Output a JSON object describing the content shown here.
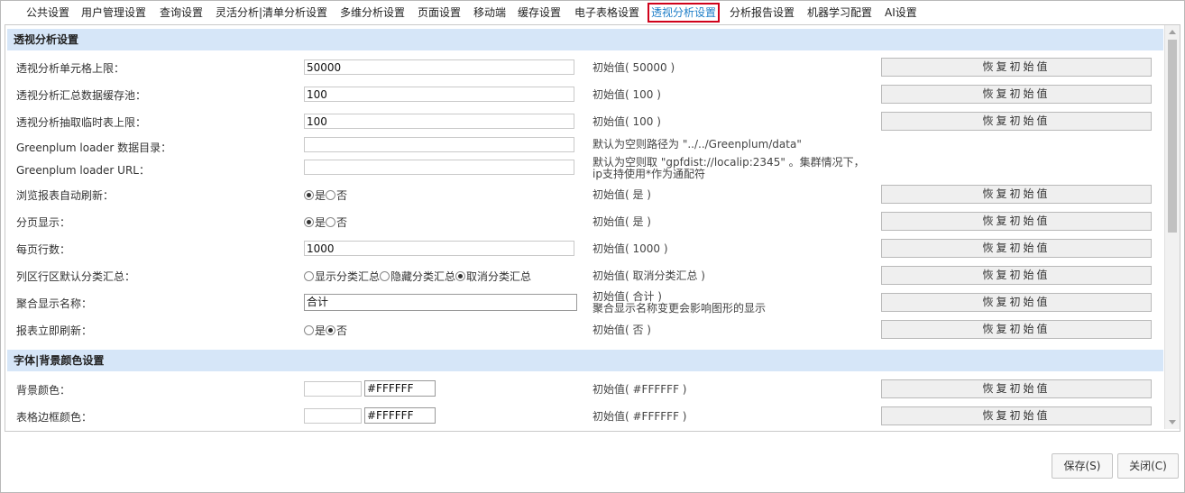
{
  "tabs": [
    {
      "label": "公共设置"
    },
    {
      "label": "用户管理设置"
    },
    {
      "label": "查询设置"
    },
    {
      "label": "灵活分析|清单分析设置"
    },
    {
      "label": "多维分析设置"
    },
    {
      "label": "页面设置"
    },
    {
      "label": "移动端"
    },
    {
      "label": "缓存设置"
    },
    {
      "label": "电子表格设置"
    },
    {
      "label": "透视分析设置",
      "active": true
    },
    {
      "label": "分析报告设置"
    },
    {
      "label": "机器学习配置"
    },
    {
      "label": "AI设置"
    }
  ],
  "sections": {
    "pivot": "透视分析设置",
    "colors": "字体|背景颜色设置"
  },
  "restore_label": "恢复初始值",
  "rows": {
    "cell_limit": {
      "label": "透视分析单元格上限：",
      "value": "50000",
      "hint": "初始值( 50000 )"
    },
    "cache_pool": {
      "label": "透视分析汇总数据缓存池：",
      "value": "100",
      "hint": "初始值( 100 )"
    },
    "temp_table": {
      "label": "透视分析抽取临时表上限：",
      "value": "100",
      "hint": "初始值( 100 )"
    },
    "gp_dir": {
      "label": "Greenplum loader 数据目录：",
      "value": "",
      "hint": "默认为空则路径为 \"../../Greenplum/data\""
    },
    "gp_url": {
      "label": "Greenplum loader URL：",
      "value": "",
      "hint1": "默认为空则取 \"gpfdist://localip:2345\" 。集群情况下，",
      "hint2": "ip支持使用*作为通配符"
    },
    "auto_refresh": {
      "label": "浏览报表自动刷新：",
      "opt1": "是",
      "opt2": "否",
      "hint": "初始值( 是 )"
    },
    "paging": {
      "label": "分页显示：",
      "opt1": "是",
      "opt2": "否",
      "hint": "初始值( 是 )"
    },
    "rows_per_page": {
      "label": "每页行数：",
      "value": "1000",
      "hint": "初始值( 1000 )"
    },
    "subtotal": {
      "label": "列区行区默认分类汇总：",
      "opt1": "显示分类汇总",
      "opt2": "隐藏分类汇总",
      "opt3": "取消分类汇总",
      "hint": "初始值( 取消分类汇总 )"
    },
    "agg_name": {
      "label": "聚合显示名称：",
      "value": "合计",
      "hint1": "初始值( 合计 )",
      "hint2": "聚合显示名称变更会影响图形的显示"
    },
    "instant_refresh": {
      "label": "报表立即刷新：",
      "opt1": "是",
      "opt2": "否",
      "hint": "初始值( 否 )"
    },
    "bg_color": {
      "label": "背景颜色：",
      "value": "#FFFFFF",
      "hint": "初始值( #FFFFFF )"
    },
    "border_color": {
      "label": "表格边框颜色：",
      "value": "#FFFFFF",
      "hint": "初始值( #FFFFFF )"
    }
  },
  "footer": {
    "save": "保存(S)",
    "close": "关闭(C)"
  },
  "colors": {
    "section_bg": "#d6e6f8",
    "active_tab": "#1e7ec8",
    "active_border": "#d0021b"
  }
}
